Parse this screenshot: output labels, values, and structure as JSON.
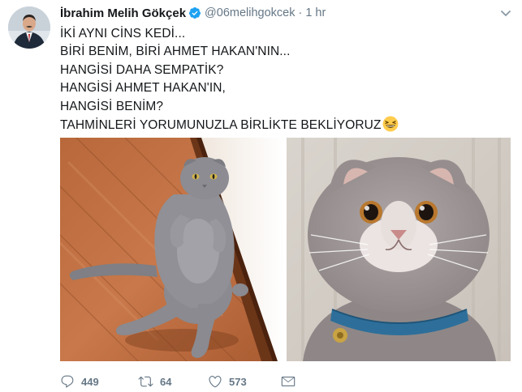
{
  "tweet": {
    "author_name": "İbrahim Melih Gökçek",
    "handle": "@06melihgokcek",
    "separator": "·",
    "time": "1 hr",
    "text_lines": [
      "İKİ AYNI CİNS KEDİ...",
      "BİRİ BENİM, BİRİ AHMET HAKAN'NIN...",
      "HANGİSİ DAHA SEMPATİK?",
      "HANGİSİ AHMET HAKAN'IN,",
      "HANGİSİ BENİM?",
      "TAHMİNLERİ YORUMUNUZLA BİRLİKTE BEKLİYORUZ"
    ],
    "emoji": "grinning-squinting-face-emoji",
    "photos": [
      "grey-cat-sitting-on-wood-floor-photo",
      "grey-cat-with-blue-collar-closeup-photo"
    ],
    "actions": {
      "replies": "449",
      "retweets": "64",
      "likes": "573"
    }
  },
  "icons": {
    "verified": "verified-badge-icon",
    "caret": "chevron-down-icon",
    "reply": "reply-icon",
    "retweet": "retweet-icon",
    "like": "heart-icon",
    "message": "direct-message-icon"
  },
  "colors": {
    "text": "#14171a",
    "secondary": "#657786",
    "verified_blue": "#1da1f2",
    "background": "#ffffff"
  }
}
